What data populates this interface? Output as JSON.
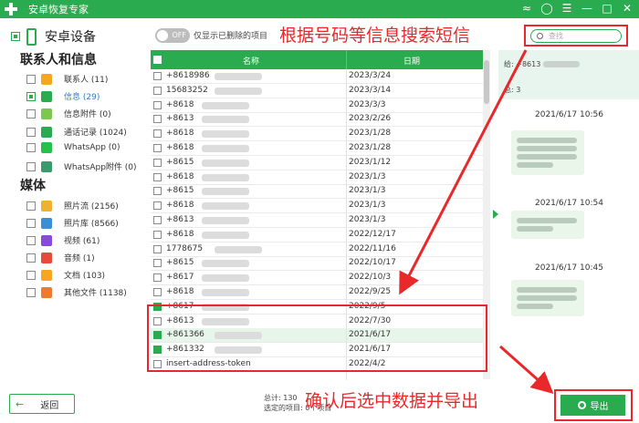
{
  "app": {
    "title": "安卓恢复专家"
  },
  "annotations": {
    "search_hint": "根据号码等信息搜索短信",
    "export_hint": "确认后选中数据并导出"
  },
  "sidebar": {
    "device_name": "安卓设备",
    "section_contacts": "联系人和信息",
    "section_media": "媒体",
    "items": [
      {
        "label": "联系人 (11)",
        "icon": "contacts-icon",
        "color": "#f5a623",
        "checked": false
      },
      {
        "label": "信息 (29)",
        "icon": "message-icon",
        "color": "#2bab4f",
        "checked": "partial",
        "active": true
      },
      {
        "label": "信息附件 (0)",
        "icon": "attachment-icon",
        "color": "#7cc84f",
        "checked": false
      },
      {
        "label": "通话记录 (1024)",
        "icon": "phone-icon",
        "color": "#2bab4f",
        "checked": false
      },
      {
        "label": "WhatsApp (0)",
        "icon": "whatsapp-icon",
        "color": "#25c04a",
        "checked": false
      },
      {
        "label": "WhatsApp附件 (0)",
        "icon": "whatsapp-attachment-icon",
        "color": "#3a9a6a",
        "checked": false
      },
      {
        "label": "照片流 (2156)",
        "icon": "photo-stream-icon",
        "color": "#f0b030",
        "checked": false
      },
      {
        "label": "照片库 (8566)",
        "icon": "photo-library-icon",
        "color": "#3a8fd8",
        "checked": false
      },
      {
        "label": "视频 (61)",
        "icon": "video-icon",
        "color": "#8a4ad8",
        "checked": false
      },
      {
        "label": "音频 (1)",
        "icon": "audio-icon",
        "color": "#e84a3a",
        "checked": false
      },
      {
        "label": "文档 (103)",
        "icon": "folder-icon",
        "color": "#f5a623",
        "checked": false
      },
      {
        "label": "其他文件 (1138)",
        "icon": "other-files-icon",
        "color": "#f07a2a",
        "checked": false
      }
    ],
    "back_label": "返回"
  },
  "toolbar": {
    "toggle_label": "OFF",
    "toggle_desc": "仅显示已删除的项目",
    "search_placeholder": "查找"
  },
  "table": {
    "col_name": "名称",
    "col_date": "日期",
    "rows": [
      {
        "name": "+8618986",
        "date": "2023/3/24",
        "checked": false
      },
      {
        "name": "15683252",
        "date": "2023/3/14",
        "checked": false
      },
      {
        "name": "+8618",
        "date": "2023/3/3",
        "checked": false
      },
      {
        "name": "+8613",
        "date": "2023/2/26",
        "checked": false
      },
      {
        "name": "+8618",
        "date": "2023/1/28",
        "checked": false
      },
      {
        "name": "+8618",
        "date": "2023/1/28",
        "checked": false
      },
      {
        "name": "+8615",
        "date": "2023/1/12",
        "checked": false
      },
      {
        "name": "+8618",
        "date": "2023/1/3",
        "checked": false
      },
      {
        "name": "+8615",
        "date": "2023/1/3",
        "checked": false
      },
      {
        "name": "+8618",
        "date": "2023/1/3",
        "checked": false
      },
      {
        "name": "+8613",
        "date": "2023/1/3",
        "checked": false
      },
      {
        "name": "+8618",
        "date": "2022/12/17",
        "checked": false
      },
      {
        "name": "1778675",
        "date": "2022/11/16",
        "checked": false
      },
      {
        "name": "+8615",
        "date": "2022/10/17",
        "checked": false
      },
      {
        "name": "+8617",
        "date": "2022/10/3",
        "checked": false
      },
      {
        "name": "+8618",
        "date": "2022/9/25",
        "checked": false
      },
      {
        "name": "+8617",
        "date": "2022/9/5",
        "checked": true
      },
      {
        "name": "+8613",
        "date": "2022/7/30",
        "checked": false
      },
      {
        "name": "+861366",
        "date": "2021/6/17",
        "checked": true,
        "highlight": true
      },
      {
        "name": "+861332",
        "date": "2021/6/17",
        "checked": true
      },
      {
        "name": "insert-address-token",
        "date": "2022/4/2",
        "checked": false
      }
    ]
  },
  "detail": {
    "to_label": "给: +8613",
    "total_label": "总: 3",
    "messages": [
      {
        "time": "2021/6/17 10:56",
        "lines": 4
      },
      {
        "time": "2021/6/17 10:54",
        "lines": 2
      },
      {
        "time": "2021/6/17 10:45",
        "lines": 3
      }
    ]
  },
  "footer": {
    "status_total": "总计: 130",
    "status_selected": "选定的项目: 0个项目",
    "export_label": "导出"
  }
}
